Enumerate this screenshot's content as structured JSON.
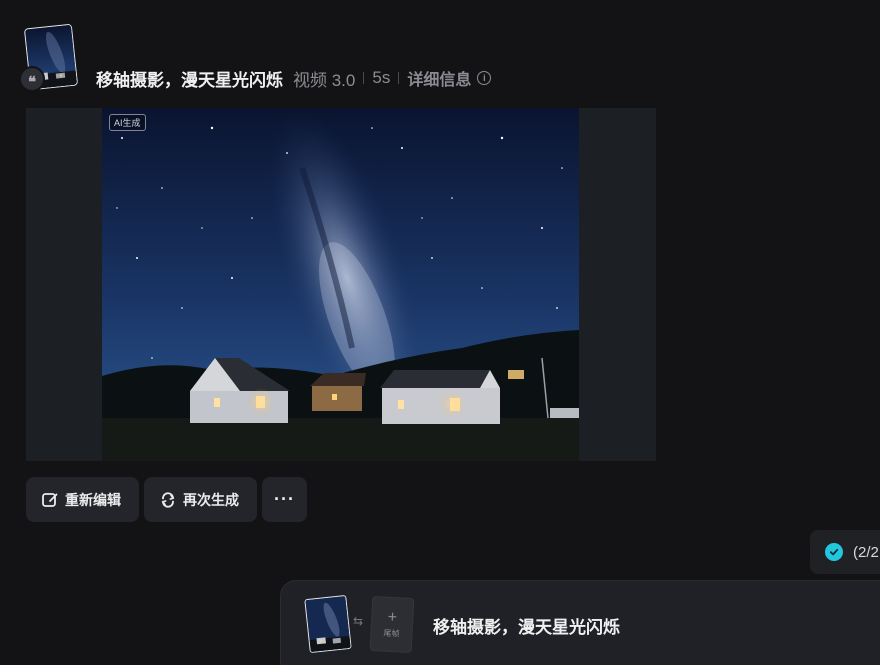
{
  "header": {
    "prompt": "移轴摄影，漫天星光闪烁",
    "model": "视频 3.0",
    "duration": "5s",
    "details_label": "详细信息"
  },
  "media": {
    "ai_tag": "AI生成"
  },
  "actions": {
    "reedit_label": "重新编辑",
    "regenerate_label": "再次生成",
    "more_label": "···"
  },
  "status": {
    "text": "(2/2"
  },
  "composer": {
    "last_frame_label": "尾帧",
    "prompt": "移轴摄影，漫天星光闪烁"
  },
  "icons": {
    "quote": "quote-icon",
    "info": "info-icon",
    "edit": "edit-icon",
    "regenerate": "regenerate-icon",
    "more": "more-icon",
    "check": "check-circle-icon",
    "swap": "swap-icon",
    "add": "plus-icon"
  },
  "colors": {
    "background": "#131316",
    "panel": "#24252a",
    "accent_check": "#22c7df"
  }
}
